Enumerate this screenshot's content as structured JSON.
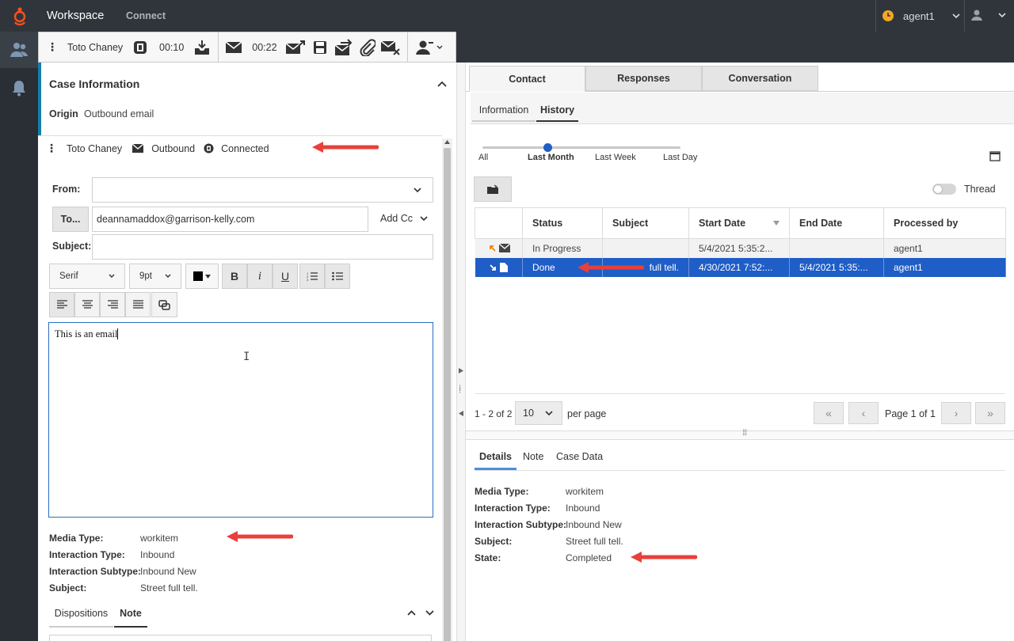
{
  "topbar": {
    "app_title": "Workspace",
    "connect_label": "Connect",
    "agent_name": "agent1",
    "agent_status_color": "#f5a623"
  },
  "toolbar": {
    "contact_name": "Toto Chaney",
    "timer1": "00:10",
    "timer2": "00:22"
  },
  "case_info": {
    "title": "Case Information",
    "origin_label": "Origin",
    "origin_value": "Outbound email"
  },
  "interaction": {
    "contact": "Toto Chaney",
    "direction": "Outbound",
    "state": "Connected"
  },
  "compose": {
    "from_label": "From:",
    "from_value": "",
    "to_label": "To...",
    "to_value": "deannamaddox@garrison-kelly.com",
    "add_cc": "Add Cc",
    "subject_label": "Subject:",
    "subject_value": "",
    "font_family": "Serif",
    "font_size": "9pt",
    "body_text": "This is an email"
  },
  "left_details": {
    "media_type_label": "Media Type:",
    "media_type_value": "workitem",
    "interaction_type_label": "Interaction Type:",
    "interaction_type_value": "Inbound",
    "interaction_subtype_label": "Interaction Subtype:",
    "interaction_subtype_value": "Inbound New",
    "subject_label": "Subject:",
    "subject_value": "Street full tell."
  },
  "left_tabs": {
    "dispositions": "Dispositions",
    "note": "Note"
  },
  "right_tabs": [
    "Contact",
    "Responses",
    "Conversation"
  ],
  "sub_tabs": [
    "Information",
    "History"
  ],
  "timeline": [
    "All",
    "Last Month",
    "Last Week",
    "Last Day"
  ],
  "thread_label": "Thread",
  "history_table": {
    "headers": [
      "Status",
      "Subject",
      "Start Date",
      "End Date",
      "Processed by"
    ],
    "rows": [
      {
        "status": "In Progress",
        "subject": "",
        "start": "5/4/2021 5:35:2...",
        "end": "",
        "processed": "agent1"
      },
      {
        "status": "Done",
        "subject": "full tell.",
        "start": "4/30/2021 7:52:...",
        "end": "5/4/2021 5:35:...",
        "processed": "agent1"
      }
    ]
  },
  "pager": {
    "range": "1 - 2 of 2",
    "per_page_value": "10",
    "per_page_label": "per page",
    "page_text": "Page 1 of 1"
  },
  "detail_tabs": [
    "Details",
    "Note",
    "Case Data"
  ],
  "right_details": {
    "media_type_label": "Media Type:",
    "media_type_value": "workitem",
    "interaction_type_label": "Interaction Type:",
    "interaction_type_value": "Inbound",
    "interaction_subtype_label": "Interaction Subtype:",
    "interaction_subtype_value": "Inbound New",
    "subject_label": "Subject:",
    "subject_value": "Street full tell.",
    "state_label": "State:",
    "state_value": "Completed"
  },
  "colors": {
    "accent": "#157fa9",
    "selected_row": "#1f5dc7",
    "arrow": "#e8403a",
    "brand_orange": "#ff4f1f"
  }
}
